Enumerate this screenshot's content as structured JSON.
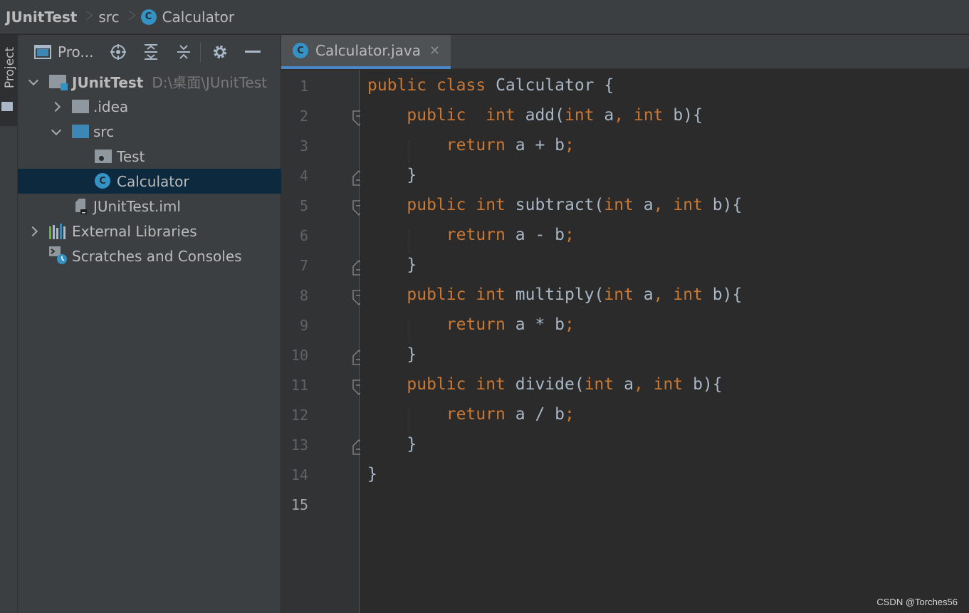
{
  "breadcrumb": [
    "JUnitTest",
    "src",
    "Calculator"
  ],
  "project_panel": {
    "stripe_label": "Project",
    "title": "Pro...",
    "tree": [
      {
        "label": "JUnitTest",
        "hint": "D:\\桌面\\JUnitTest",
        "icon": "module-folder-icon",
        "expanded": true
      },
      {
        "label": ".idea",
        "icon": "folder-icon",
        "expanded": false
      },
      {
        "label": "src",
        "icon": "source-folder-icon",
        "expanded": true
      },
      {
        "label": "Test",
        "icon": "test-folder-icon"
      },
      {
        "label": "Calculator",
        "icon": "class-icon",
        "selected": true
      },
      {
        "label": "JUnitTest.iml",
        "icon": "iml-file-icon"
      },
      {
        "label": "External Libraries",
        "icon": "libraries-icon",
        "expanded": false
      },
      {
        "label": "Scratches and Consoles",
        "icon": "scratches-icon"
      }
    ]
  },
  "editor": {
    "tab": {
      "label": "Calculator.java",
      "icon": "class-icon"
    },
    "current_line": 15,
    "lines": [
      {
        "n": "1",
        "text": "public class Calculator {"
      },
      {
        "n": "2",
        "text": "    public  int add(int a, int b){"
      },
      {
        "n": "3",
        "text": "        return a + b;"
      },
      {
        "n": "4",
        "text": "    }"
      },
      {
        "n": "5",
        "text": "    public int subtract(int a, int b){"
      },
      {
        "n": "6",
        "text": "        return a - b;"
      },
      {
        "n": "7",
        "text": "    }"
      },
      {
        "n": "8",
        "text": "    public int multiply(int a, int b){"
      },
      {
        "n": "9",
        "text": "        return a * b;"
      },
      {
        "n": "10",
        "text": "    }"
      },
      {
        "n": "11",
        "text": "    public int divide(int a, int b){"
      },
      {
        "n": "12",
        "text": "        return a / b;"
      },
      {
        "n": "13",
        "text": "    }"
      },
      {
        "n": "14",
        "text": "}"
      },
      {
        "n": "15",
        "text": ""
      }
    ]
  },
  "colors": {
    "keyword": "#cc7832",
    "text": "#a9b7c6",
    "selection": "#0d293e",
    "accent": "#4a88c7"
  },
  "watermark": "CSDN @Torches56"
}
